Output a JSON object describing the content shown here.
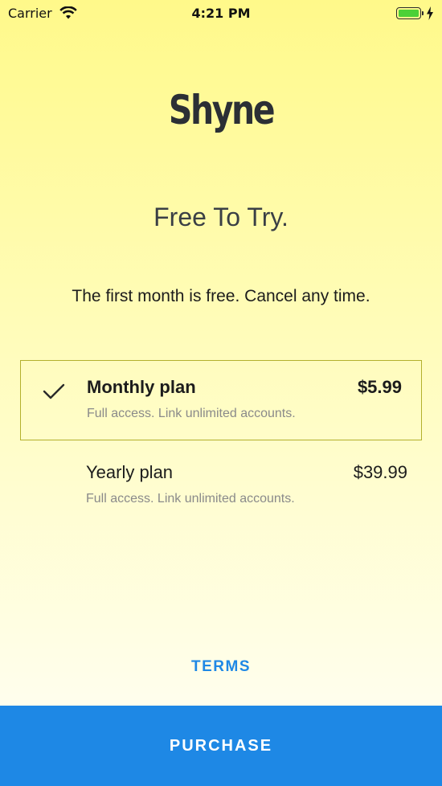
{
  "status_bar": {
    "carrier": "Carrier",
    "time": "4:21 PM",
    "battery_color": "#4cd137",
    "icons": [
      "wifi-icon",
      "battery-icon",
      "charging-bolt-icon"
    ]
  },
  "logo": {
    "text": "Shyne"
  },
  "headline": "Free To Try.",
  "subline": "The first month is free.  Cancel any time.",
  "plans": [
    {
      "name": "Monthly plan",
      "price": "$5.99",
      "description": "Full access. Link unlimited accounts.",
      "selected": true,
      "icon": "checkmark-icon"
    },
    {
      "name": "Yearly plan",
      "price": "$39.99",
      "description": "Full access. Link unlimited accounts.",
      "selected": false
    }
  ],
  "terms_label": "TERMS",
  "purchase_label": "PURCHASE",
  "colors": {
    "accent": "#1e88e5",
    "selected_border": "#b3b02d",
    "background_top": "#fff98a",
    "background_bottom": "#fffef8"
  }
}
